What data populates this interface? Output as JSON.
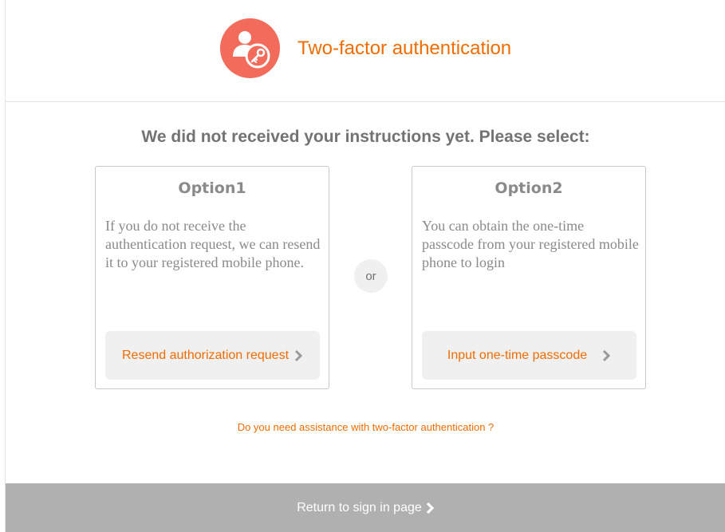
{
  "header": {
    "title": "Two-factor authentication",
    "logo_icon": "user-key-icon",
    "accent_color": "#f06c00",
    "logo_color": "#f26b5b"
  },
  "prompt": "We did not received your instructions yet. Please select:",
  "options": [
    {
      "title": "Option1",
      "description": "If you do not receive the authentication request, we can resend it to your registered mobile phone.",
      "action_label": "Resend authorization request",
      "action_icon": "chevron-right-icon"
    },
    {
      "title": "Option2",
      "description": "You can obtain the one-time passcode from your registered mobile phone to login",
      "action_label": "Input one-time passcode",
      "action_icon": "chevron-right-icon"
    }
  ],
  "separator": "or",
  "help_link": "Do you need assistance with two-factor authentication ?",
  "footer": {
    "label": "Return to sign in page",
    "icon": "chevron-right-icon",
    "background": "#b0b0b0"
  }
}
